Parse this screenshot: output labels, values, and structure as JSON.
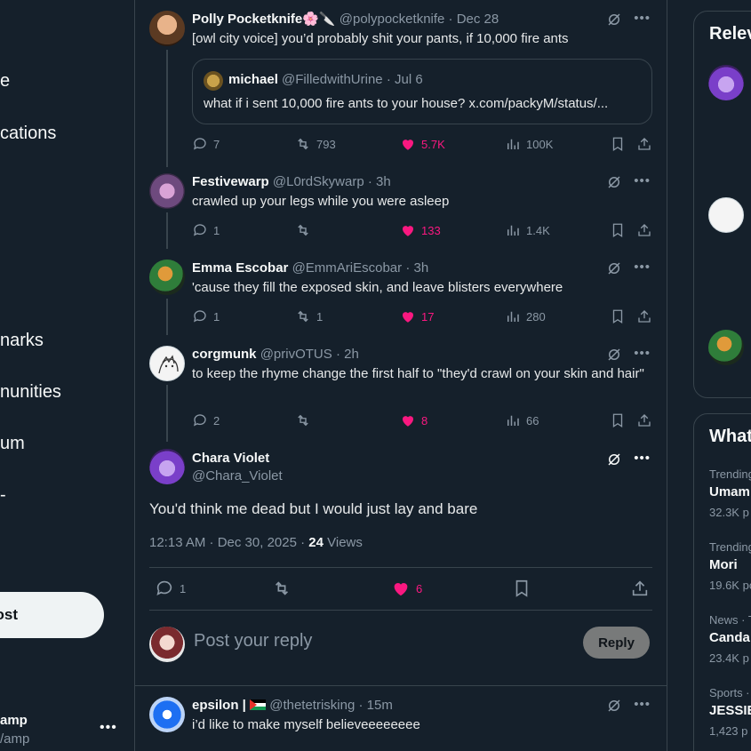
{
  "nav": {
    "items": [
      "e",
      "cations",
      "narks",
      "nunities",
      "um",
      "-"
    ],
    "post_label": "ost",
    "account_name": "amp",
    "account_handle": "/amp",
    "more": "•••"
  },
  "thread": [
    {
      "name": "Polly Pocketknife🌸🔪",
      "handle": "@polypocketknife",
      "time": "· Dec 28",
      "text": "[owl city voice] you’d probably shit your pants, if 10,000 fire ants",
      "quote": {
        "name": "michael",
        "handle": "@FilledwithUrine",
        "time": "· Jul 6",
        "text": "what if i sent 10,000 fire ants to your house? x.com/packyM/status/..."
      },
      "replies": "7",
      "reposts": "793",
      "likes": "5.7K",
      "views": "100K",
      "liked": true
    },
    {
      "name": "Festivewarp",
      "handle": "@L0rdSkywarp",
      "time": "· 3h",
      "text": "crawled up your legs while you were asleep",
      "replies": "1",
      "reposts": "",
      "likes": "133",
      "views": "1.4K",
      "liked": true
    },
    {
      "name": "Emma Escobar",
      "handle": "@EmmAriEscobar",
      "time": "· 3h",
      "text": "'cause they fill the exposed skin, and leave blisters everywhere",
      "replies": "1",
      "reposts": "1",
      "likes": "17",
      "views": "280",
      "liked": true
    },
    {
      "name": "corgmunk",
      "handle": "@privOTUS",
      "time": "· 2h",
      "text": "to keep the rhyme change the first half to \"they'd crawl on your skin and hair\"",
      "replies": "2",
      "reposts": "",
      "likes": "8",
      "views": "66",
      "liked": true
    }
  ],
  "focus": {
    "name": "Chara Violet",
    "handle": "@Chara_Violet",
    "text": "You'd think me dead but I would just lay and bare",
    "timestamp": "12:13 AM · Dec 30, 2025 · ",
    "views_count": "24",
    "views_label": " Views",
    "replies": "1",
    "likes": "6"
  },
  "reply_box": {
    "placeholder": "Post your reply",
    "button": "Reply"
  },
  "next_reply": {
    "name": "epsilon |",
    "handle": "@thetetrisking",
    "time": "· 15m",
    "text": "i’d like to make myself believeeeeeeee"
  },
  "right": {
    "relevant_title": "Relev",
    "whats_title": "What",
    "trends": [
      {
        "meta": "Trending",
        "name": "Umam",
        "count": "32.3K p"
      },
      {
        "meta": "Trending",
        "name": "Mori",
        "count": "19.6K po"
      },
      {
        "meta": "News · T",
        "name": "Canda",
        "count": "23.4K p"
      },
      {
        "meta": "Sports ·",
        "name": "JESSIE",
        "count": "1,423 p"
      }
    ]
  },
  "colors": {
    "background": "#15202b",
    "border": "#38444d",
    "like_pink": "#f91880",
    "muted": "#8b98a5"
  }
}
